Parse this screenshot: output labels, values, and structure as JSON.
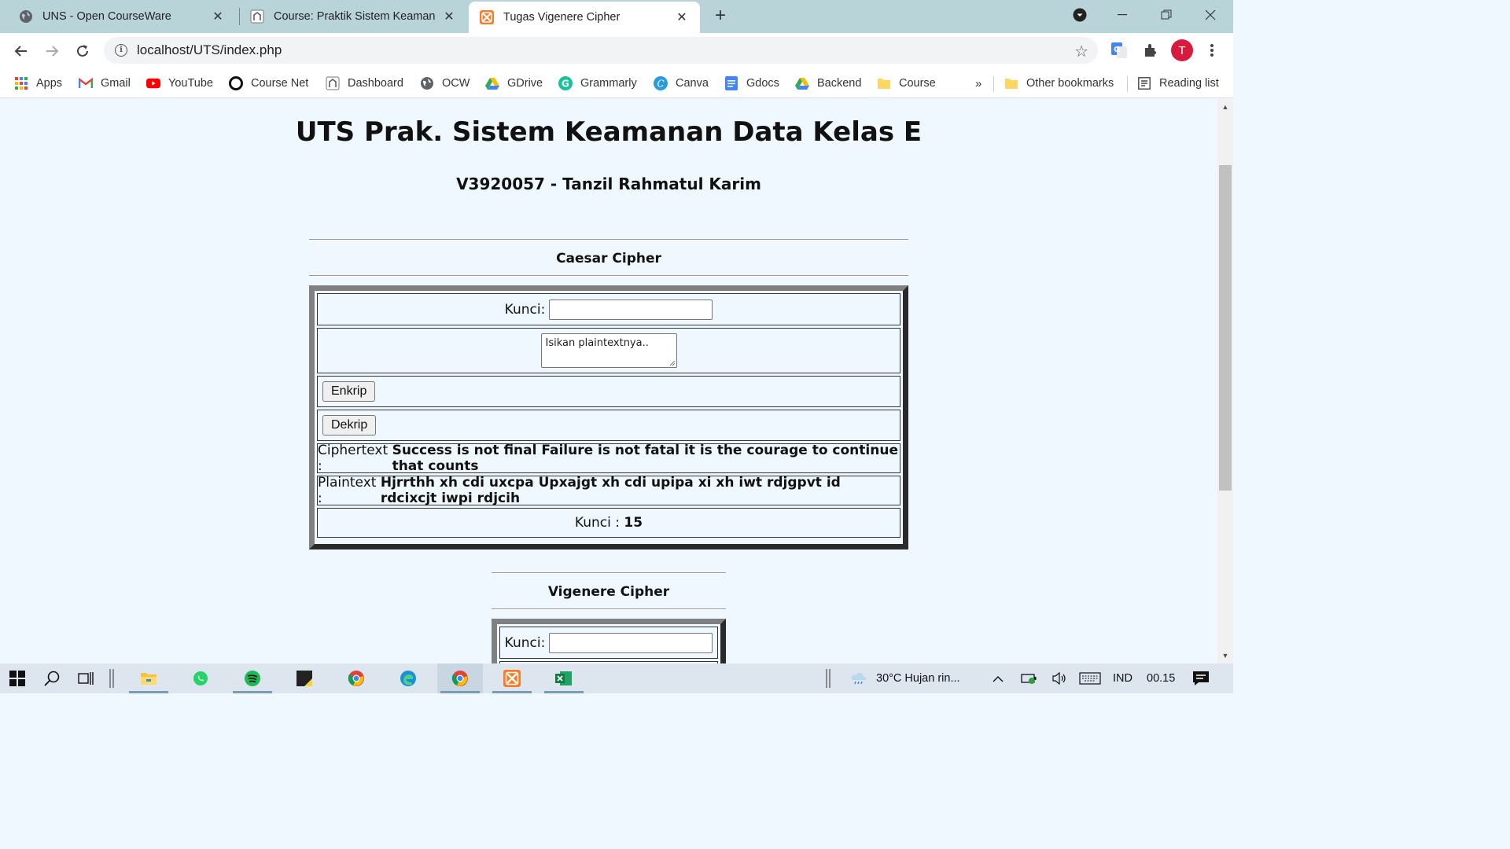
{
  "browser": {
    "tabs": [
      {
        "title": "UNS - Open CourseWare",
        "icon": "globe-icon",
        "active": false
      },
      {
        "title": "Course: Praktik Sistem Keamanan",
        "icon": "moodle-icon",
        "active": false
      },
      {
        "title": "Tugas Vigenere Cipher",
        "icon": "xampp-icon",
        "active": true
      }
    ],
    "url": "localhost/UTS/index.php",
    "profile_initial": "T",
    "bookmarks": [
      {
        "label": "Apps",
        "icon": "apps-grid-icon"
      },
      {
        "label": "Gmail",
        "icon": "gmail-icon"
      },
      {
        "label": "YouTube",
        "icon": "youtube-icon"
      },
      {
        "label": "Course Net",
        "icon": "course-net-icon"
      },
      {
        "label": "Dashboard",
        "icon": "moodle-icon"
      },
      {
        "label": "OCW",
        "icon": "globe-icon"
      },
      {
        "label": "GDrive",
        "icon": "google-drive-icon"
      },
      {
        "label": "Grammarly",
        "icon": "grammarly-icon"
      },
      {
        "label": "Canva",
        "icon": "canva-icon"
      },
      {
        "label": "Gdocs",
        "icon": "google-docs-icon"
      },
      {
        "label": "Backend",
        "icon": "google-drive-icon"
      },
      {
        "label": "Course",
        "icon": "folder-icon"
      }
    ],
    "overflow_label": "»",
    "other_bookmarks": "Other bookmarks",
    "reading_list": "Reading list"
  },
  "page": {
    "title": "UTS Prak. Sistem Keamanan Data Kelas E",
    "subtitle": "V3920057 - Tanzil Rahmatul Karim",
    "caesar": {
      "heading": "Caesar Cipher",
      "key_label": "Kunci:",
      "key_value": "",
      "textarea_placeholder": "Isikan plaintextnya..",
      "encrypt_label": "Enkrip",
      "decrypt_label": "Dekrip",
      "ciphertext_label": "Ciphertext :",
      "ciphertext_value": "Success is not final Failure is not fatal it is the courage to continue that counts",
      "plaintext_label": "Plaintext :",
      "plaintext_value": "Hjrrthh xh cdi uxcpa Upxajgt xh cdi upipa xi xh iwt rdjgpvt id rdcixcjt iwpi rdjcih",
      "key_result_label": "Kunci :",
      "key_result_value": "15"
    },
    "vigenere": {
      "heading": "Vigenere Cipher",
      "key_label": "Kunci:",
      "key_value": ""
    }
  },
  "taskbar": {
    "apps": [
      "file-explorer-icon",
      "whatsapp-icon",
      "spotify-icon",
      "sticky-notes-icon",
      "chrome-icon",
      "edge-icon",
      "chrome-canary-icon",
      "xampp-icon",
      "excel-icon"
    ],
    "weather": "30°C  Hujan rin...",
    "language": "IND",
    "time": "00.15"
  },
  "colors": {
    "page_background": "#f0f8ff",
    "tabstrip": "#b9d4d8",
    "taskbar": "#dde6ee",
    "profile": "#d81b3c"
  }
}
